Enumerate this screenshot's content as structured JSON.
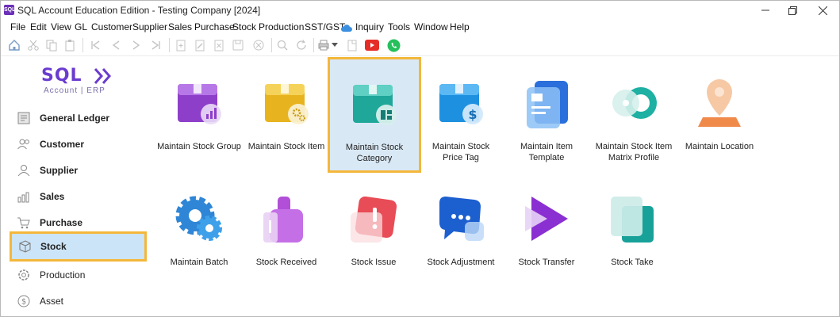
{
  "window": {
    "title": "SQL Account Education Edition - Testing Company [2024]"
  },
  "menu": [
    "File",
    "Edit",
    "View",
    "GL",
    "Customer",
    "Supplier",
    "Sales",
    "Purchase",
    "Stock",
    "Production",
    "SST/GST",
    "Inquiry",
    "Tools",
    "Window",
    "Help"
  ],
  "logo": {
    "main": "SQL",
    "sub": "Account | ERP"
  },
  "sidebar": {
    "items": [
      {
        "label": "General Ledger",
        "icon": "ledger-icon"
      },
      {
        "label": "Customer",
        "icon": "customer-icon"
      },
      {
        "label": "Supplier",
        "icon": "supplier-icon"
      },
      {
        "label": "Sales",
        "icon": "sales-icon"
      },
      {
        "label": "Purchase",
        "icon": "purchase-icon"
      },
      {
        "label": "Stock",
        "icon": "stock-icon",
        "selected": true
      },
      {
        "label": "Production",
        "icon": "production-icon"
      },
      {
        "label": "Asset",
        "icon": "asset-icon"
      }
    ]
  },
  "tiles": [
    {
      "label": "Maintain Stock Group",
      "icon": "stock-group-icon"
    },
    {
      "label": "Maintain Stock Item",
      "icon": "stock-item-icon"
    },
    {
      "label": "Maintain Stock Category",
      "icon": "stock-category-icon",
      "selected": true
    },
    {
      "label": "Maintain Stock Price Tag",
      "icon": "price-tag-icon"
    },
    {
      "label": "Maintain Item Template",
      "icon": "item-template-icon"
    },
    {
      "label": "Maintain Stock Item Matrix Profile",
      "icon": "matrix-profile-icon"
    },
    {
      "label": "Maintain Location",
      "icon": "location-icon"
    },
    {
      "label": "Maintain Batch",
      "icon": "batch-icon"
    },
    {
      "label": "Stock Received",
      "icon": "stock-received-icon"
    },
    {
      "label": "Stock Issue",
      "icon": "stock-issue-icon"
    },
    {
      "label": "Stock Adjustment",
      "icon": "stock-adjustment-icon"
    },
    {
      "label": "Stock Transfer",
      "icon": "stock-transfer-icon"
    },
    {
      "label": "Stock Take",
      "icon": "stock-take-icon"
    }
  ],
  "colors": {
    "highlight": "#f4b73a",
    "selected_bg": "#cce4f7",
    "brand": "#6a3ccf"
  }
}
